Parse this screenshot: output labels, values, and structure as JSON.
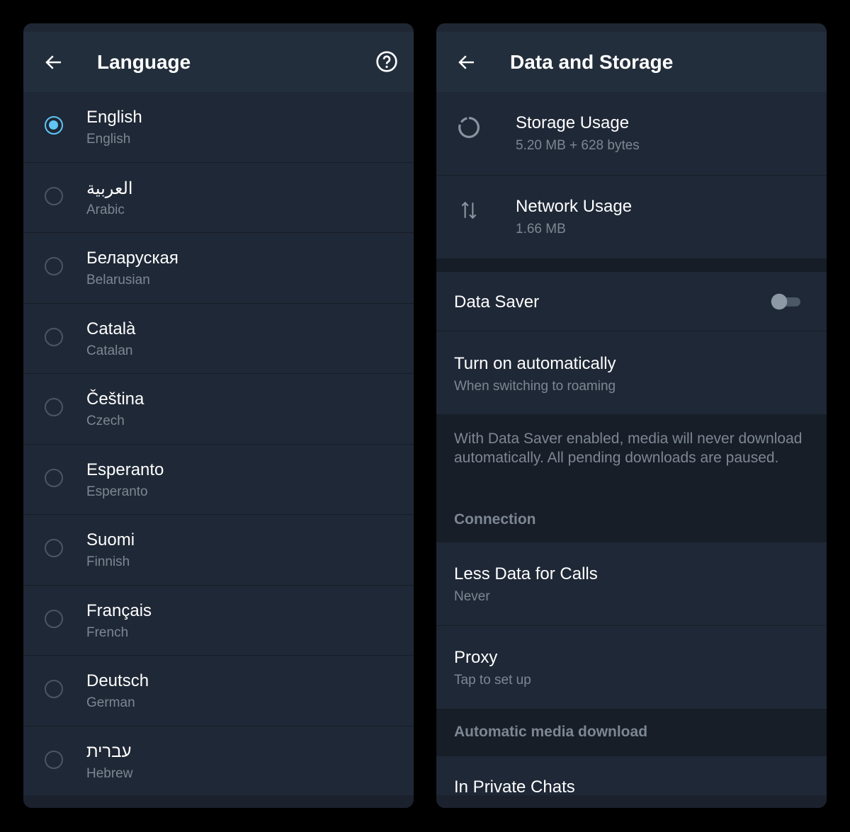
{
  "language_screen": {
    "title": "Language",
    "back_icon": "arrow-left-icon",
    "help_icon": "question-circle-icon",
    "items": [
      {
        "name": "English",
        "sub": "English",
        "selected": true
      },
      {
        "name": "العربية",
        "sub": "Arabic",
        "selected": false
      },
      {
        "name": "Беларуская",
        "sub": "Belarusian",
        "selected": false
      },
      {
        "name": "Català",
        "sub": "Catalan",
        "selected": false
      },
      {
        "name": "Čeština",
        "sub": "Czech",
        "selected": false
      },
      {
        "name": "Esperanto",
        "sub": "Esperanto",
        "selected": false
      },
      {
        "name": "Suomi",
        "sub": "Finnish",
        "selected": false
      },
      {
        "name": "Français",
        "sub": "French",
        "selected": false
      },
      {
        "name": "Deutsch",
        "sub": "German",
        "selected": false
      },
      {
        "name": "עברית",
        "sub": "Hebrew",
        "selected": false
      }
    ]
  },
  "data_screen": {
    "title": "Data and Storage",
    "storage": {
      "label": "Storage Usage",
      "value": "5.20 MB + 628 bytes",
      "icon": "pie-chart-icon"
    },
    "network": {
      "label": "Network Usage",
      "value": "1.66 MB",
      "icon": "arrows-up-down-icon"
    },
    "data_saver": {
      "label": "Data Saver",
      "enabled": false
    },
    "auto": {
      "label": "Turn on automatically",
      "value": "When switching to roaming"
    },
    "info": "With Data Saver enabled, media will never download automatically. All pending downloads are paused.",
    "connection_header": "Connection",
    "calls": {
      "label": "Less Data for Calls",
      "value": "Never"
    },
    "proxy": {
      "label": "Proxy",
      "value": "Tap to set up"
    },
    "media_header": "Automatic media download",
    "private": {
      "label": "In Private Chats"
    }
  },
  "colors": {
    "accent": "#5fc6f5",
    "panel": "#1f2836",
    "header": "#232e3c"
  }
}
